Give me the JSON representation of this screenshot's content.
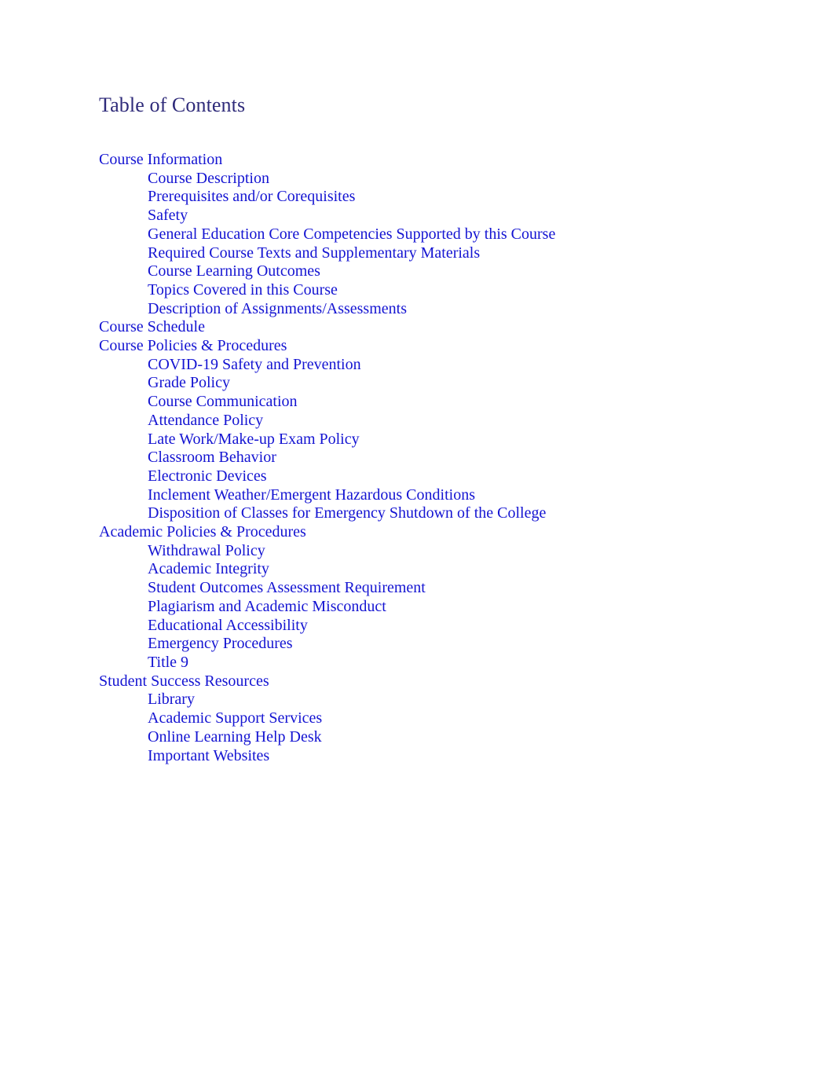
{
  "document": {
    "title": "Table of Contents",
    "title_color": "#2F2B7A",
    "link_color": "#1414D2",
    "background_color": "#FFFFFF"
  },
  "toc": {
    "heading": "Table of Contents",
    "entries": [
      {
        "label": "Course Information",
        "level": 1
      },
      {
        "label": "Course Description",
        "level": 2
      },
      {
        "label": "Prerequisites and/or Corequisites",
        "level": 2
      },
      {
        "label": "Safety",
        "level": 2
      },
      {
        "label": "General Education Core Competencies Supported by this Course",
        "level": 2
      },
      {
        "label": "Required Course Texts and Supplementary Materials",
        "level": 2
      },
      {
        "label": "Course Learning Outcomes",
        "level": 2
      },
      {
        "label": "Topics Covered in this Course",
        "level": 2
      },
      {
        "label": "Description of Assignments/Assessments",
        "level": 2
      },
      {
        "label": "Course Schedule",
        "level": 1
      },
      {
        "label": "Course Policies & Procedures",
        "level": 1
      },
      {
        "label": "COVID-19 Safety and Prevention",
        "level": 2
      },
      {
        "label": "Grade Policy",
        "level": 2
      },
      {
        "label": "Course Communication",
        "level": 2
      },
      {
        "label": "Attendance Policy",
        "level": 2
      },
      {
        "label": "Late Work/Make-up Exam Policy",
        "level": 2
      },
      {
        "label": "Classroom Behavior",
        "level": 2
      },
      {
        "label": "Electronic Devices",
        "level": 2
      },
      {
        "label": "Inclement Weather/Emergent Hazardous Conditions",
        "level": 2
      },
      {
        "label": "Disposition of Classes for Emergency Shutdown of the College",
        "level": 2
      },
      {
        "label": "Academic Policies & Procedures",
        "level": 1
      },
      {
        "label": "Withdrawal Policy",
        "level": 2
      },
      {
        "label": "Academic Integrity",
        "level": 2
      },
      {
        "label": "Student Outcomes Assessment Requirement",
        "level": 2
      },
      {
        "label": "Plagiarism and Academic Misconduct",
        "level": 2
      },
      {
        "label": "Educational Accessibility",
        "level": 2
      },
      {
        "label": "Emergency Procedures",
        "level": 2
      },
      {
        "label": "Title 9",
        "level": 2
      },
      {
        "label": "Student Success Resources",
        "level": 1
      },
      {
        "label": "Library",
        "level": 2
      },
      {
        "label": "Academic Support Services",
        "level": 2
      },
      {
        "label": "Online Learning Help Desk",
        "level": 2
      },
      {
        "label": "Important Websites",
        "level": 2
      }
    ]
  }
}
